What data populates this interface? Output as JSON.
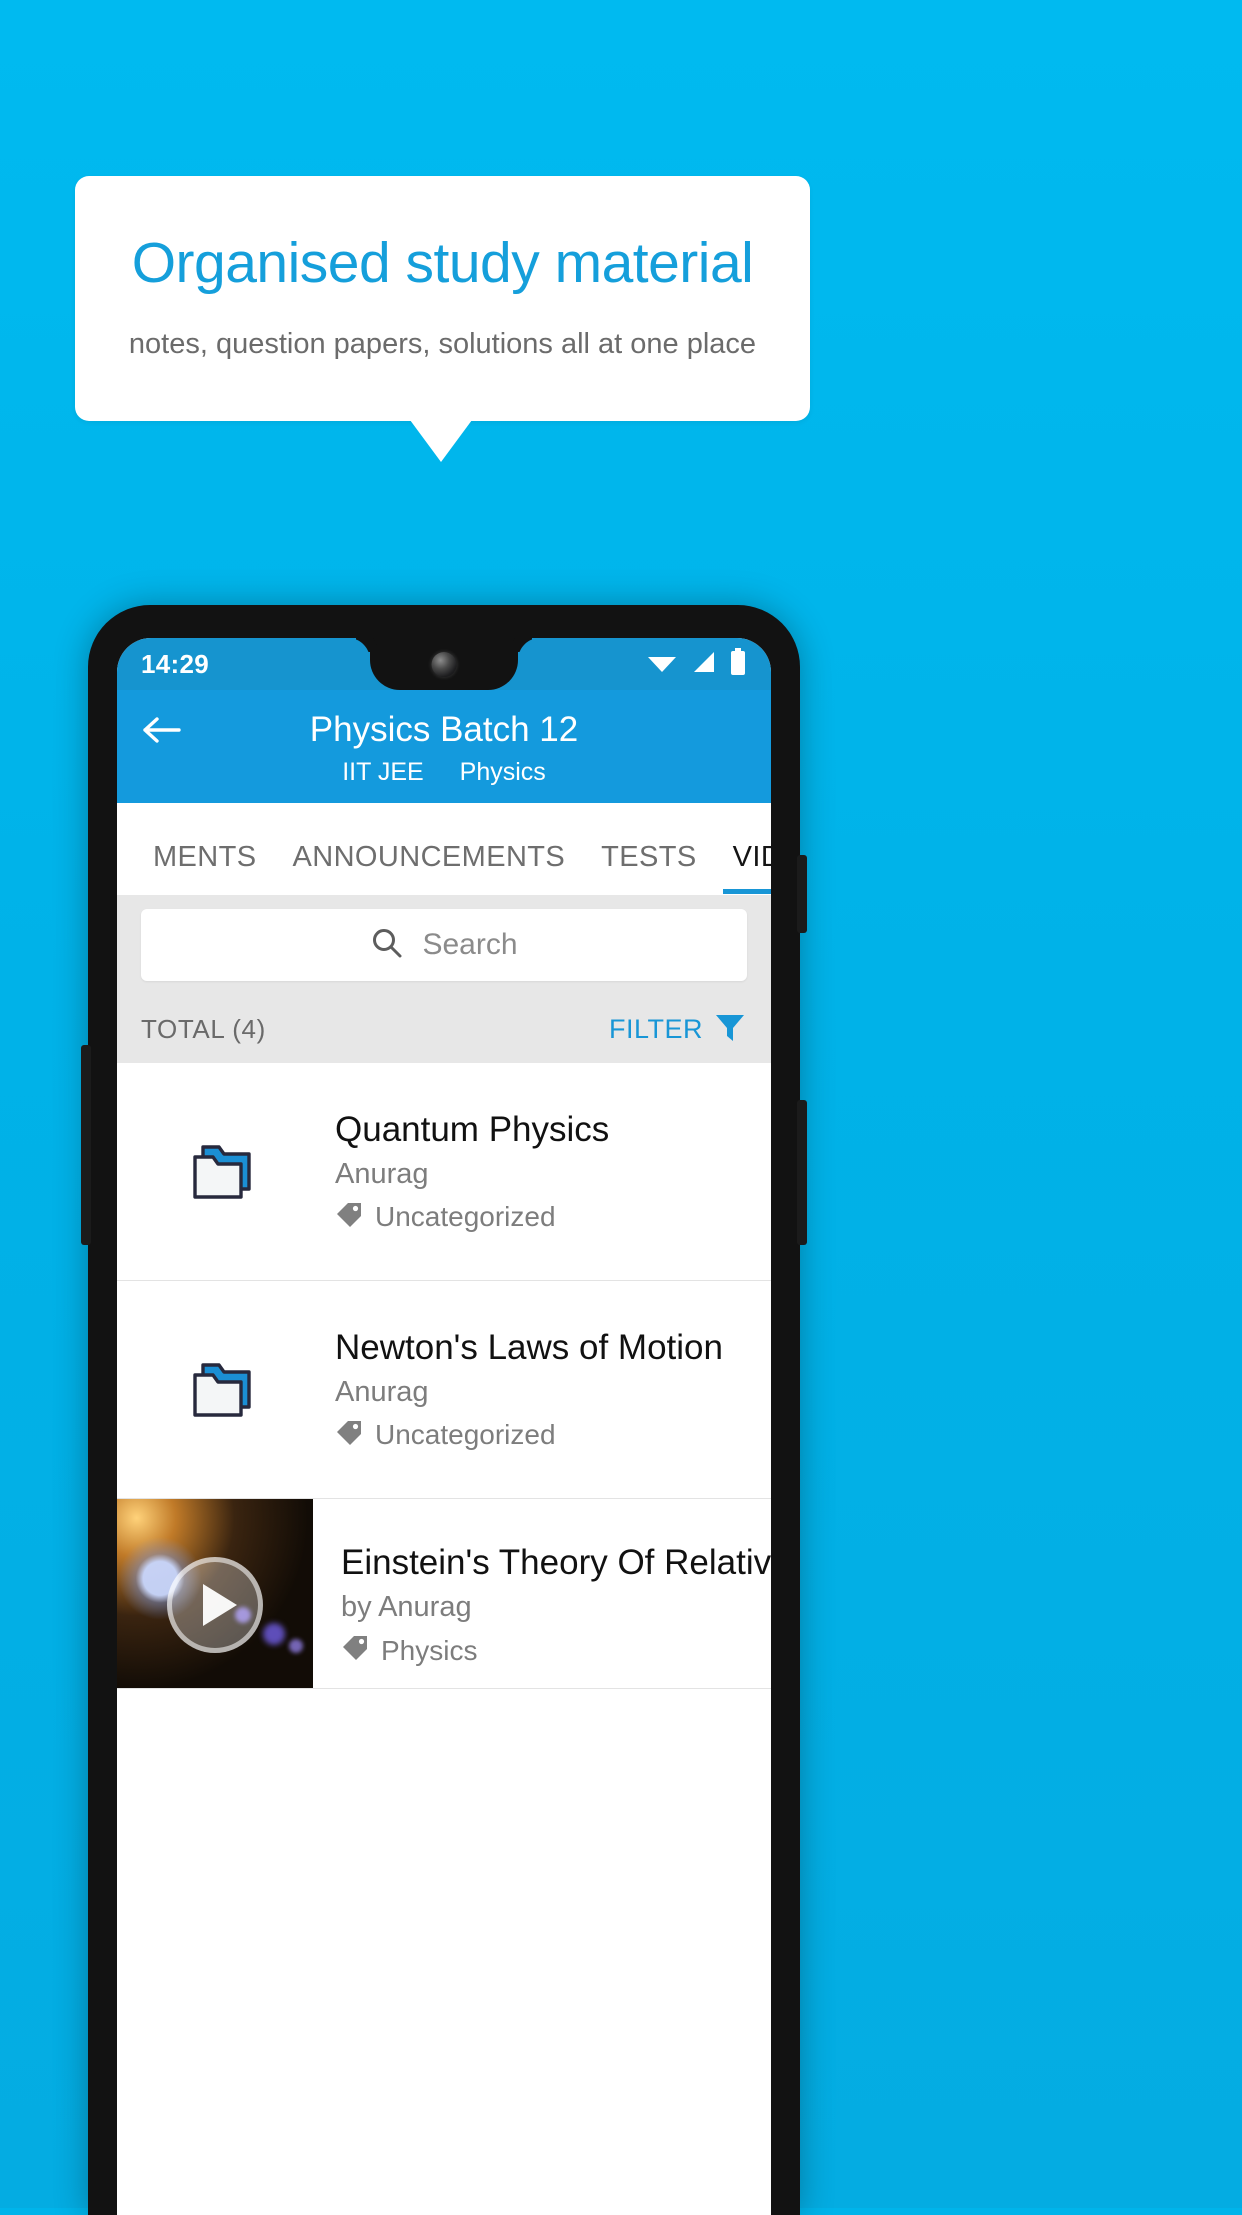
{
  "promo": {
    "title": "Organised study material",
    "subtitle": "notes, question papers, solutions all at one place",
    "title_color": "#159fdb",
    "background_color": "#00b4ea"
  },
  "status_bar": {
    "time": "14:29",
    "icons": [
      "wifi-icon",
      "signal-icon",
      "battery-icon"
    ]
  },
  "app_bar": {
    "back_icon": "back-arrow-icon",
    "title": "Physics Batch 12",
    "subtitle_exam": "IIT JEE",
    "subtitle_subject": "Physics",
    "color": "#149add"
  },
  "tabs": [
    {
      "label": "MENTS",
      "active": false
    },
    {
      "label": "ANNOUNCEMENTS",
      "active": false
    },
    {
      "label": "TESTS",
      "active": false
    },
    {
      "label": "VIDEOS",
      "active": true
    }
  ],
  "search": {
    "placeholder": "Search",
    "value": "",
    "icon": "search-icon"
  },
  "toolbar": {
    "total_label": "TOTAL (4)",
    "filter_label": "FILTER",
    "filter_icon": "filter-funnel-icon",
    "filter_color": "#1896d6"
  },
  "list": [
    {
      "type": "folder",
      "icon": "folder-icon",
      "title": "Quantum Physics",
      "author": "Anurag",
      "tag_icon": "tag-icon",
      "tag": "Uncategorized"
    },
    {
      "type": "folder",
      "icon": "folder-icon",
      "title": "Newton's Laws of Motion",
      "author": "Anurag",
      "tag_icon": "tag-icon",
      "tag": "Uncategorized"
    },
    {
      "type": "video",
      "icon": "play-icon",
      "title": "Einstein's Theory Of Relativity",
      "author": "by Anurag",
      "tag_icon": "tag-icon",
      "tag": "Physics"
    }
  ]
}
